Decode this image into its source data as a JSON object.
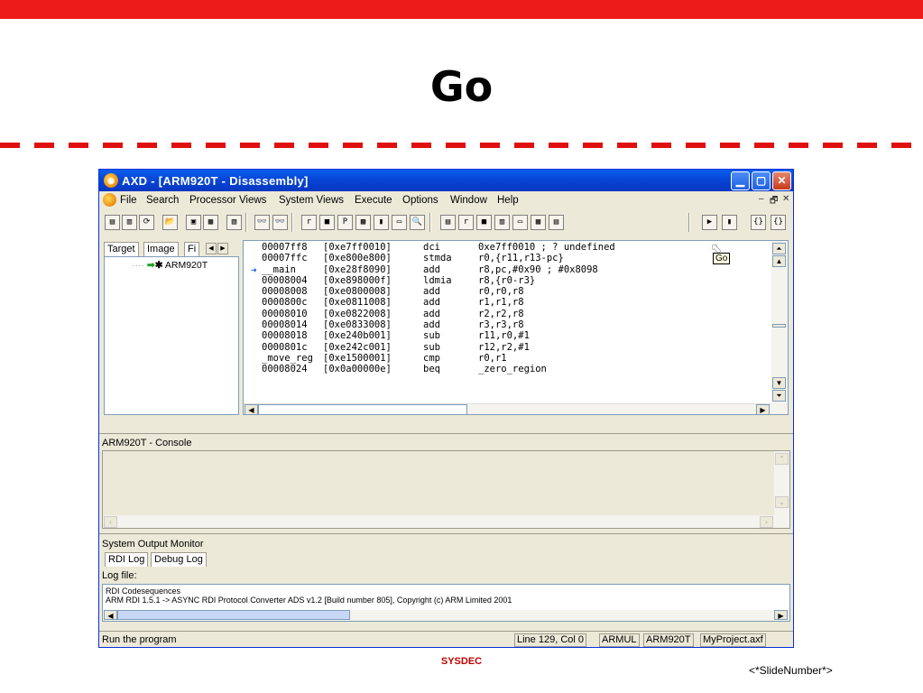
{
  "slide": {
    "title": "Go",
    "footer_brand": "SYSDEC",
    "slide_number": "<*SlideNumber*>",
    "accent_color": "#ee1b1b"
  },
  "window": {
    "title": "AXD - [ARM920T - Disassembly]",
    "controls": {
      "minimize": "▁",
      "maximize": "▢",
      "close": "✕"
    },
    "mdi_controls": {
      "minimize": "–",
      "restore": "🗗",
      "close": "✕"
    }
  },
  "menu": [
    "File",
    "Search",
    "Processor Views",
    "System Views",
    "Execute",
    "Options",
    "Window",
    "Help"
  ],
  "toolbar": {
    "buttons": [
      "▤",
      "▥",
      "⟳",
      "📂",
      "▣",
      "▦",
      "▧",
      "👓",
      "👓",
      "r",
      "■",
      "P",
      "▩",
      "▮",
      "▭",
      "🔍",
      "▤",
      "r",
      "■",
      "▥",
      "▭",
      "▦",
      "▤",
      "▶",
      "▮",
      "{}",
      "{}"
    ]
  },
  "left_panel": {
    "tabs": [
      "Target",
      "Image",
      "Fi"
    ],
    "tree_item": "ARM920T",
    "tree_icon": "chip-icon"
  },
  "disassembly": {
    "rows": [
      {
        "label": "00007ff8",
        "hex": "[0xe7ff0010]",
        "op": "dci",
        "arg": "0xe7ff0010 ; ? undefined"
      },
      {
        "label": "00007ffc",
        "hex": "[0xe800e800]",
        "op": "stmda",
        "arg": "r0,{r11,r13-pc}"
      },
      {
        "label": "__main",
        "hex": "[0xe28f8090]",
        "op": "add",
        "arg": "r8,pc,#0x90 ; #0x8098",
        "current": true
      },
      {
        "label": "00008004",
        "hex": "[0xe898000f]",
        "op": "ldmia",
        "arg": "r8,{r0-r3}"
      },
      {
        "label": "00008008",
        "hex": "[0xe0800008]",
        "op": "add",
        "arg": "r0,r0,r8"
      },
      {
        "label": "0000800c",
        "hex": "[0xe0811008]",
        "op": "add",
        "arg": "r1,r1,r8"
      },
      {
        "label": "00008010",
        "hex": "[0xe0822008]",
        "op": "add",
        "arg": "r2,r2,r8"
      },
      {
        "label": "00008014",
        "hex": "[0xe0833008]",
        "op": "add",
        "arg": "r3,r3,r8"
      },
      {
        "label": "00008018",
        "hex": "[0xe240b001]",
        "op": "sub",
        "arg": "r11,r0,#1"
      },
      {
        "label": "0000801c",
        "hex": "[0xe242c001]",
        "op": "sub",
        "arg": "r12,r2,#1"
      },
      {
        "label": "_move_reg",
        "hex": "[0xe1500001]",
        "op": "cmp",
        "arg": "r0,r1"
      },
      {
        "label": "00008024",
        "hex": "[0x0a00000e]",
        "op": "beq",
        "arg": "_zero_region"
      }
    ],
    "tooltip": "Go"
  },
  "console": {
    "title": "ARM920T - Console"
  },
  "output_monitor": {
    "title": "System Output Monitor",
    "tabs": [
      "RDI Log",
      "Debug Log"
    ],
    "log_file_label": "Log file:",
    "log_lines": [
      "RDI Codesequences",
      "ARM RDI 1.5.1 -> ASYNC RDI Protocol Converter ADS v1.2 [Build number 805], Copyright (c) ARM Limited 2001"
    ]
  },
  "status_bar": {
    "message": "Run the program",
    "position": "Line 129, Col 0",
    "target": "ARMUL",
    "processor": "ARM920T",
    "project": "MyProject.axf"
  }
}
